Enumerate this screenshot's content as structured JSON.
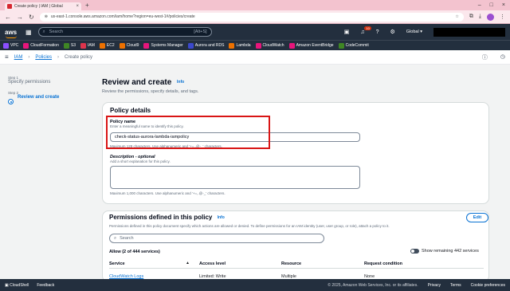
{
  "browser": {
    "tab_title": "Create policy | IAM | Global",
    "url": "us-east-1.console.aws.amazon.com/iam/home?region=eu-west-1#/policies/create"
  },
  "topnav": {
    "logo": "aws",
    "search_placeholder": "Search",
    "search_shortcut": "[Alt+S]",
    "notifications_count": "10",
    "region": "Global"
  },
  "favorites": [
    {
      "label": "VPC",
      "color": "#8c4fff"
    },
    {
      "label": "CloudFormation",
      "color": "#e7157b"
    },
    {
      "label": "S3",
      "color": "#3f8624"
    },
    {
      "label": "IAM",
      "color": "#dd344c"
    },
    {
      "label": "EC2",
      "color": "#ed7100"
    },
    {
      "label": "Cloud9",
      "color": "#ed7100"
    },
    {
      "label": "Systems Manager",
      "color": "#e7157b"
    },
    {
      "label": "Aurora and RDS",
      "color": "#3b48cc"
    },
    {
      "label": "Lambda",
      "color": "#ed7100"
    },
    {
      "label": "CloudWatch",
      "color": "#e7157b"
    },
    {
      "label": "Amazon EventBridge",
      "color": "#e7157b"
    },
    {
      "label": "CodeCommit",
      "color": "#3f8624"
    }
  ],
  "breadcrumb": {
    "items": [
      "IAM",
      "Policies",
      "Create policy"
    ]
  },
  "steps": [
    {
      "step": "Step 1",
      "label": "Specify permissions"
    },
    {
      "step": "Step 2",
      "label": "Review and create"
    }
  ],
  "page": {
    "title": "Review and create",
    "info": "Info",
    "subtitle": "Review the permissions, specify details, and tags."
  },
  "policy_details": {
    "heading": "Policy details",
    "name_label": "Policy name",
    "name_desc": "Enter a meaningful name to identify this policy.",
    "name_value": "check-status-aurora-lambda-iampolicy",
    "name_constraint": "Maximum 128 characters. Use alphanumeric and '+=,.@-_' characters.",
    "desc_label": "Description - optional",
    "desc_desc": "Add a short explanation for this policy.",
    "desc_constraint": "Maximum 1,000 characters. Use alphanumeric and '+=,.@-_' characters."
  },
  "permissions": {
    "heading": "Permissions defined in this policy",
    "info": "Info",
    "edit_label": "Edit",
    "desc": "Permissions defined in this policy document specify which actions are allowed or denied. To define permissions for an IAM identity (user, user group, or role), attach a policy to it.",
    "search_placeholder": "Search",
    "allow_label": "Allow (2 of 444 services)",
    "toggle_label": "Show remaining 442 services",
    "columns": [
      "Service",
      "Access level",
      "Resource",
      "Request condition"
    ],
    "row": {
      "service": "CloudWatch Logs",
      "access": "Limited: Write",
      "resource": "Multiple",
      "condition": "None"
    }
  },
  "footer": {
    "cloudshell": "CloudShell",
    "feedback": "Feedback",
    "copyright": "© 2025, Amazon Web Services, Inc. or its affiliates.",
    "privacy": "Privacy",
    "terms": "Terms",
    "cookies": "Cookie preferences"
  }
}
